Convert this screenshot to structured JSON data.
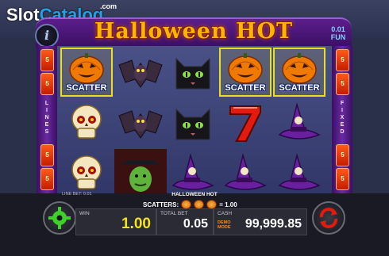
{
  "watermark": {
    "slot": "Slot",
    "catalog": "Catalog",
    "com": ".com"
  },
  "header": {
    "title": "Halloween HOT",
    "info_glyph": "i",
    "coin_value": "0.01",
    "coin_mode": "FUN"
  },
  "rails": {
    "left_numbers": [
      "5",
      "5",
      "5",
      "5",
      "5",
      "5"
    ],
    "right_numbers": [
      "5",
      "5",
      "5",
      "5",
      "5",
      "5"
    ],
    "left_word": [
      "L",
      "I",
      "N",
      "E",
      "S"
    ],
    "right_word": [
      "F",
      "I",
      "X",
      "E",
      "D"
    ]
  },
  "reels": {
    "symbols": [
      [
        "pumpkin-scatter",
        "bat",
        "black-cat",
        "pumpkin-scatter",
        "pumpkin-scatter"
      ],
      [
        "skull",
        "bat",
        "black-cat",
        "red-seven",
        "witch-hat"
      ],
      [
        "skull",
        "witch",
        "witch-hat",
        "witch-hat",
        "witch-hat"
      ]
    ],
    "scatter_label": "SCATTER",
    "highlight_color": "#e6e01e"
  },
  "bottom": {
    "line_bet": "LINE BET: 0.01",
    "game_name": "HALLOWEEN HOT",
    "scatters_label": "SCATTERS:",
    "scatters_value": "= 1.00",
    "win_label": "WIN",
    "win_value": "1.00",
    "total_bet_label": "TOTAL BET",
    "total_bet_value": "0.05",
    "cash_label": "CASH",
    "demo_mode": "DEMO MODE",
    "cash_value": "99,999.85"
  },
  "icons": {
    "settings": "gear-icon",
    "spin": "spin-arrows-icon",
    "info": "info-icon"
  }
}
